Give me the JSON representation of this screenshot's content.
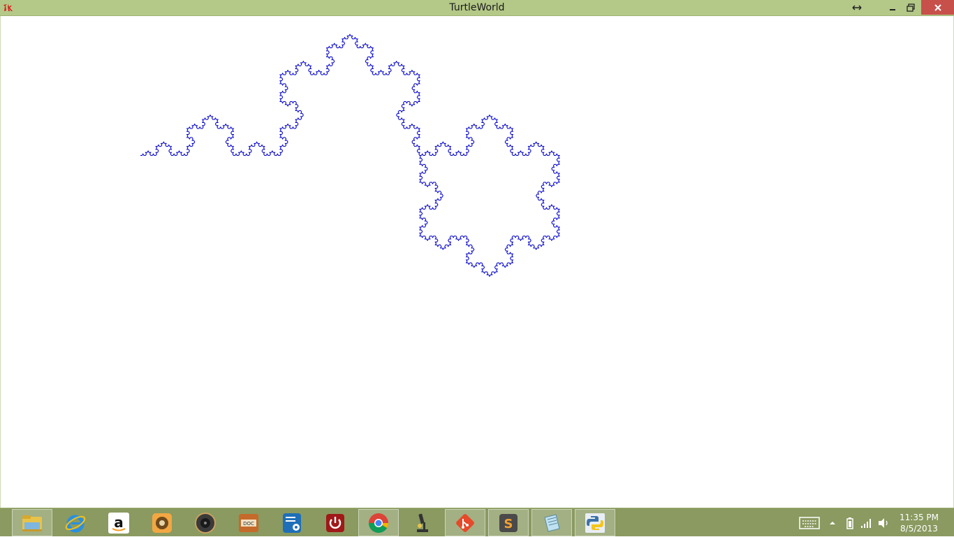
{
  "window": {
    "title": "TurtleWorld",
    "app_icon": "tk-feather-icon",
    "controls": [
      "resize-icon",
      "minimize-icon",
      "restore-icon",
      "close-icon"
    ]
  },
  "canvas": {
    "background": "#ffffff",
    "drawing": {
      "type": "koch-curve",
      "stroke_color": "#0000cc"
    }
  },
  "taskbar": {
    "pinned_apps": [
      {
        "name": "file-explorer-icon",
        "active": true
      },
      {
        "name": "internet-explorer-icon",
        "active": false
      },
      {
        "name": "amazon-icon",
        "active": false
      },
      {
        "name": "audio-app-icon",
        "active": false
      },
      {
        "name": "speaker-app-icon",
        "active": false
      },
      {
        "name": "doc-app-icon",
        "active": false
      },
      {
        "name": "settings-app-icon",
        "active": false
      },
      {
        "name": "power-app-icon",
        "active": false
      },
      {
        "name": "chrome-icon",
        "active": true
      },
      {
        "name": "microscope-icon",
        "active": false
      },
      {
        "name": "git-icon",
        "active": true
      },
      {
        "name": "sublime-text-icon",
        "active": true
      },
      {
        "name": "notepad-icon",
        "active": true
      },
      {
        "name": "python-icon",
        "active": true
      }
    ],
    "tray_icons": [
      "keyboard-icon",
      "show-hidden-icons-arrow",
      "power-icon",
      "network-signal-icon",
      "volume-icon"
    ],
    "clock": {
      "time": "11:35 PM",
      "date": "8/5/2013"
    },
    "colors": {
      "titlebar": "#b4c888",
      "taskbar": "#8a9a60",
      "close_button": "#c7504b"
    }
  }
}
